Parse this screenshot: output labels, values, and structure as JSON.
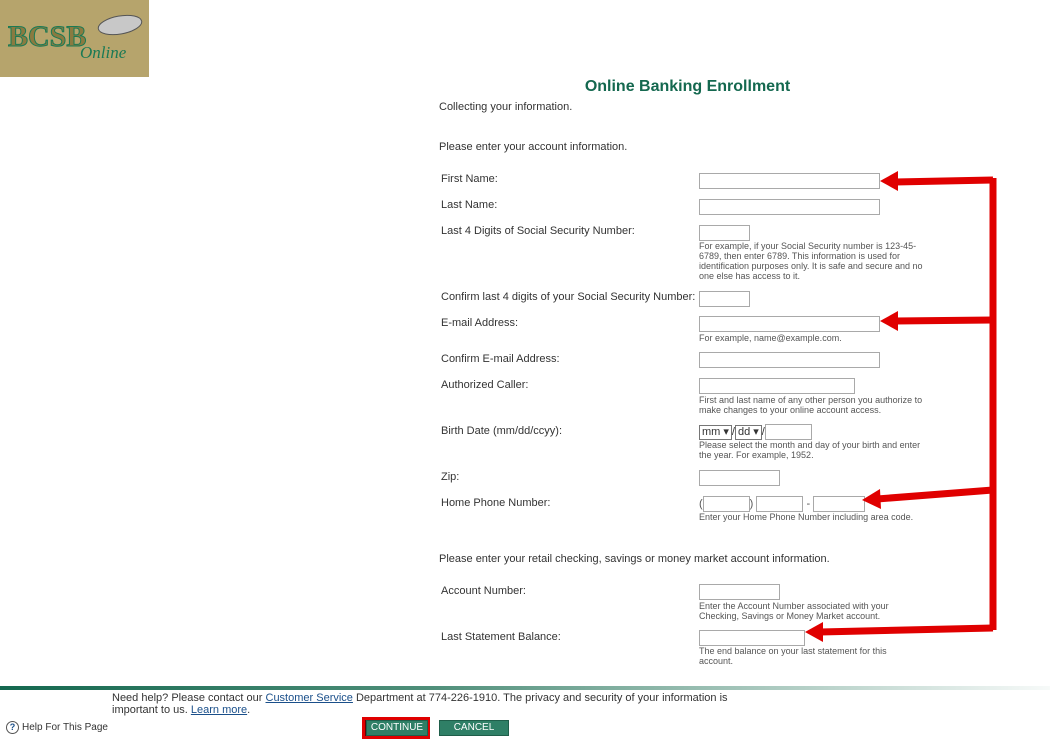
{
  "logo": {
    "text": "BCSB Online",
    "bg": "#b6a46c"
  },
  "title": "Online Banking Enrollment",
  "intro": "Collecting your information.",
  "section1": "Please enter your account information.",
  "fields": {
    "first_name": "First Name:",
    "last_name": "Last Name:",
    "ssn4": "Last 4 Digits of Social Security Number:",
    "ssn4_help": "For example, if your Social Security number is 123-45-6789, then enter 6789. This information is used for identification purposes only. It is safe and secure and no one else has access to it.",
    "ssn4_confirm": "Confirm last 4 digits of your Social Security Number:",
    "email": "E-mail Address:",
    "email_help": "For example, name@example.com.",
    "email_confirm": "Confirm E-mail Address:",
    "auth_caller": "Authorized Caller:",
    "auth_caller_help": "First and last name of any other person you authorize to make changes to your online account access.",
    "birth": "Birth Date (mm/dd/ccyy):",
    "birth_month": "mm",
    "birth_day": "dd",
    "birth_help": "Please select the month and day of your birth and enter the year. For example, 1952.",
    "zip": "Zip:",
    "phone": "Home Phone Number:",
    "phone_help": "Enter your Home Phone Number including area code."
  },
  "section2": "Please enter your retail checking, savings or money market account information.",
  "account": {
    "number": "Account Number:",
    "number_help": "Enter the Account Number associated with your Checking, Savings or Money Market account.",
    "balance": "Last Statement Balance:",
    "balance_help": "The end balance on your last statement for this account."
  },
  "footer": {
    "text1": "Need help? Please contact our ",
    "cs_link": "Customer Service",
    "text2": " Department at 774-226-1910. The privacy and security of your information is important to us. ",
    "learn_link": "Learn more",
    "text3": ".",
    "help_page": "Help For This Page",
    "continue": "CONTINUE",
    "cancel": "CANCEL"
  },
  "colors": {
    "brand": "#14684f",
    "annotation": "#e00000"
  }
}
